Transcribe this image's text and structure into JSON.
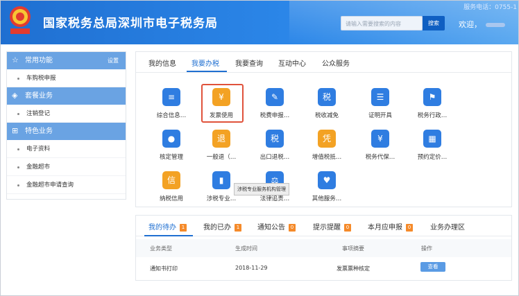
{
  "header": {
    "title": "国家税务总局深圳市电子税务局",
    "hotline": "服务电话：0755-1",
    "search_placeholder": "请输入需要搜索的内容",
    "search_button": "搜索",
    "welcome": "欢迎，",
    "brand_color": "#1f6fd1"
  },
  "sidebar": {
    "sections": [
      {
        "title": "常用功能",
        "icon": "star-icon",
        "setting": "设置",
        "items": [
          "车购税申报"
        ]
      },
      {
        "title": "套餐业务",
        "icon": "layers-icon",
        "items": [
          "注销登记"
        ]
      },
      {
        "title": "特色业务",
        "icon": "grid-icon",
        "items": [
          "电子资料",
          "金融超市",
          "金融超市申请查询"
        ]
      }
    ]
  },
  "main": {
    "tabs": [
      "我的信息",
      "我要办税",
      "我要查询",
      "互动中心",
      "公众服务"
    ],
    "active_tab": "我要办税",
    "services": [
      {
        "label": "综合信息…",
        "icon": "document-icon",
        "color": "#2f7de1"
      },
      {
        "label": "发票使用",
        "icon": "invoice-icon",
        "color": "#f3a224"
      },
      {
        "label": "税费申报…",
        "icon": "declare-icon",
        "color": "#2f7de1"
      },
      {
        "label": "税收减免",
        "icon": "tax-relief-icon",
        "color": "#2f7de1"
      },
      {
        "label": "证明开具",
        "icon": "certificate-icon",
        "color": "#2f7de1"
      },
      {
        "label": "税务行政…",
        "icon": "admin-icon",
        "color": "#2f7de1"
      },
      {
        "label": "核定管理",
        "icon": "person-icon",
        "color": "#2f7de1"
      },
      {
        "label": "一般退（…",
        "icon": "refund-icon",
        "color": "#f3a224"
      },
      {
        "label": "出口退税…",
        "icon": "export-refund-icon",
        "color": "#2f7de1"
      },
      {
        "label": "增值税抵…",
        "icon": "vat-icon",
        "color": "#f3a224"
      },
      {
        "label": "税务代保…",
        "icon": "custody-icon",
        "color": "#2f7de1"
      },
      {
        "label": "预约定价…",
        "icon": "calendar-icon",
        "color": "#2f7de1"
      },
      {
        "label": "纳税信用",
        "icon": "credit-icon",
        "color": "#f3a224"
      },
      {
        "label": "涉税专业…",
        "icon": "building-icon",
        "color": "#2f7de1"
      },
      {
        "label": "法律追责…",
        "icon": "gavel-icon",
        "color": "#2f7de1"
      },
      {
        "label": "其他服务…",
        "icon": "heart-icon",
        "color": "#2f7de1"
      }
    ],
    "tooltip": "涉税专业服务机构管理"
  },
  "tasks": {
    "tabs": [
      {
        "label": "我的待办",
        "count": "1"
      },
      {
        "label": "我的已办",
        "count": "1"
      },
      {
        "label": "通知公告",
        "count": "0"
      },
      {
        "label": "提示提醒",
        "count": "0"
      },
      {
        "label": "本月应申报",
        "count": "0"
      },
      {
        "label": "业务办理区",
        "count": ""
      }
    ],
    "columns": [
      "业务类型",
      "生成时间",
      "事项摘要",
      "操作"
    ],
    "rows": [
      {
        "type": "通知书打印",
        "time": "2018-11-29",
        "summary": "发票票种核定",
        "action": "查看"
      }
    ]
  }
}
